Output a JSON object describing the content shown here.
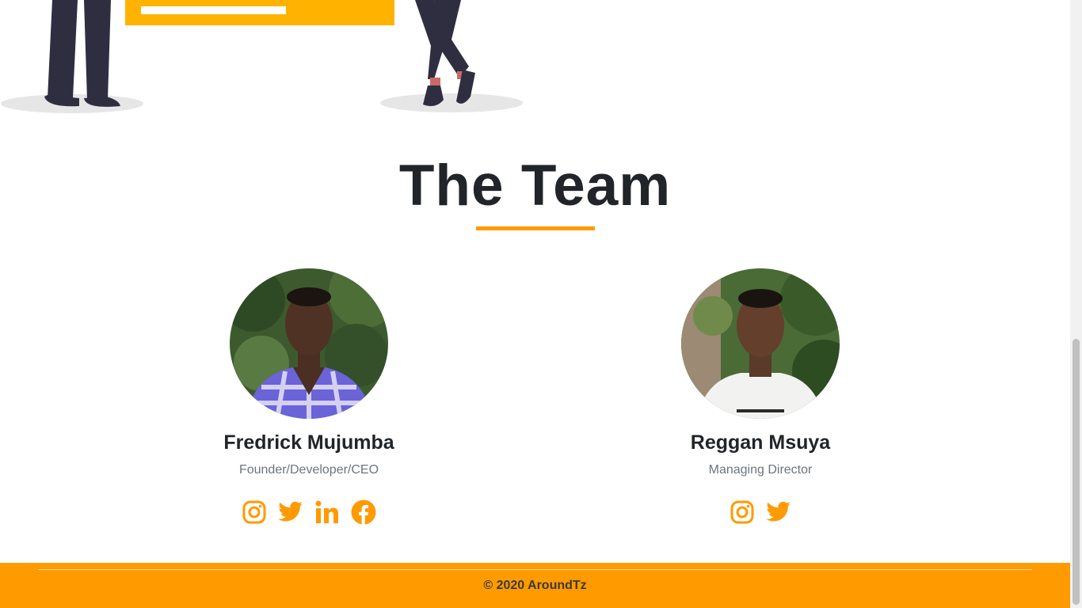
{
  "section": {
    "title": "The Team"
  },
  "team": [
    {
      "name": "Fredrick Mujumba",
      "role": "Founder/Developer/CEO",
      "socials": [
        "instagram-icon",
        "twitter-icon",
        "linkedin-icon",
        "facebook-icon"
      ]
    },
    {
      "name": "Reggan Msuya",
      "role": "Managing Director",
      "socials": [
        "instagram-icon",
        "twitter-icon"
      ]
    }
  ],
  "footer": {
    "copyright": "© 2020 AroundTz"
  },
  "colors": {
    "accent": "#ff9a00",
    "heading": "#212529",
    "muted": "#6c757d",
    "illustration_dark": "#2f2e41"
  }
}
